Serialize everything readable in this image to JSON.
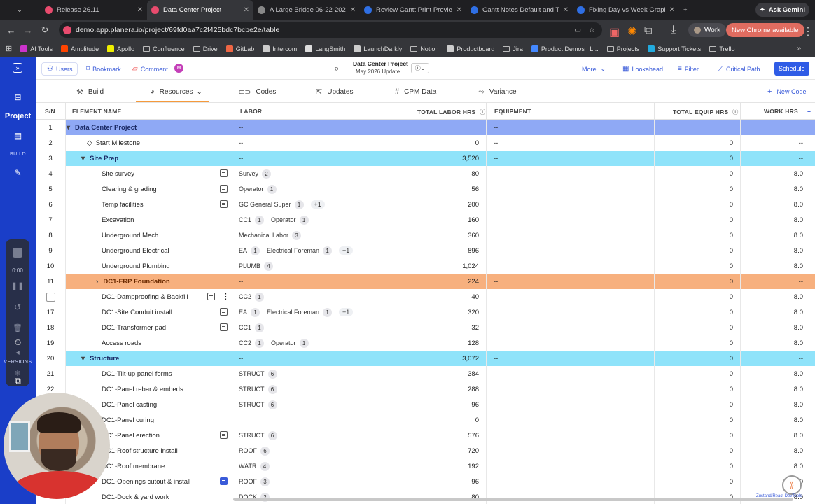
{
  "browser": {
    "tabs": [
      {
        "label": "Release 26.11",
        "icon": "planera-icon"
      },
      {
        "label": "Data Center Project",
        "icon": "planera-icon",
        "active": true
      },
      {
        "label": "A Large Bridge 06-22-202",
        "icon": "globe-icon"
      },
      {
        "label": "Review Gantt Print Preview",
        "icon": "doc-icon"
      },
      {
        "label": "Gantt Notes Default and T",
        "icon": "doc-icon"
      },
      {
        "label": "Fixing Day vs Week Graph",
        "icon": "doc-icon"
      }
    ],
    "ask_gemini": "Ask Gemini",
    "url": "demo.app.planera.io/project/69fd0aa7c2f425bdc7bcbe2e/table",
    "profile": "Work",
    "update_label": "New Chrome available",
    "bookmarks": [
      "AI Tools",
      "Amplitude",
      "Apollo",
      "Confluence",
      "Drive",
      "GitLab",
      "Intercom",
      "LangSmith",
      "LaunchDarkly",
      "Notion",
      "Productboard",
      "Jira",
      "Product Demos | L...",
      "Projects",
      "Support Tickets",
      "Trello"
    ]
  },
  "rail": {
    "project_label": "Project",
    "build_label": "BUILD",
    "versions_label": "VERSIONS",
    "timer": "0:00"
  },
  "toolbar": {
    "users": "Users",
    "bookmark": "Bookmark",
    "comment": "Comment",
    "avatar_letter": "M",
    "project_title": "Data Center Project",
    "project_subtitle": "May 2026 Update",
    "more": "More",
    "lookahead": "Lookahead",
    "filter": "Filter",
    "critical_path": "Critical Path",
    "schedule": "Schedule"
  },
  "subnav": {
    "build": "Build",
    "resources": "Resources",
    "codes": "Codes",
    "updates": "Updates",
    "cpm": "CPM Data",
    "variance": "Variance",
    "new_code": "New Code"
  },
  "columns": {
    "sn": "S/N",
    "name": "ELEMENT NAME",
    "labor": "LABOR",
    "total_labor": "TOTAL LABOR HRS",
    "equipment": "EQUIPMENT",
    "total_equip": "TOTAL EQUIP HRS",
    "work_hrs": "WORK HRS"
  },
  "rows": [
    {
      "sn": "1",
      "name": "Data Center Project",
      "style": "l0",
      "indent": 0,
      "caret": "▾",
      "labor": "--",
      "chips": [],
      "total": "",
      "equip": "--",
      "teq": "",
      "work": ""
    },
    {
      "sn": "2",
      "name": "Start Milestone",
      "style": "",
      "indent": 1,
      "milestone": true,
      "labor": "--",
      "chips": [],
      "total": "0",
      "equip": "--",
      "teq": "0",
      "work": "--"
    },
    {
      "sn": "3",
      "name": "Site Prep",
      "style": "l1",
      "indent": 1,
      "caret": "▾",
      "labor": "--",
      "chips": [],
      "total": "3,520",
      "equip": "--",
      "teq": "0",
      "work": "--"
    },
    {
      "sn": "4",
      "name": "Site survey",
      "style": "",
      "indent": 2,
      "note": true,
      "chips": [
        {
          "t": "Survey",
          "n": "2"
        }
      ],
      "total": "80",
      "teq": "0",
      "work": "8.0"
    },
    {
      "sn": "5",
      "name": "Clearing & grading",
      "style": "",
      "indent": 2,
      "note": true,
      "chips": [
        {
          "t": "Operator",
          "n": "1"
        }
      ],
      "total": "56",
      "teq": "0",
      "work": "8.0"
    },
    {
      "sn": "6",
      "name": "Temp facilities",
      "style": "",
      "indent": 2,
      "note": true,
      "chips": [
        {
          "t": "GC General Super",
          "n": "1"
        }
      ],
      "plus": "+1",
      "total": "200",
      "teq": "0",
      "work": "8.0"
    },
    {
      "sn": "7",
      "name": "Excavation",
      "style": "",
      "indent": 2,
      "chips": [
        {
          "t": "CC1",
          "n": "1"
        },
        {
          "t": "Operator",
          "n": "1"
        }
      ],
      "total": "160",
      "teq": "0",
      "work": "8.0"
    },
    {
      "sn": "8",
      "name": "Underground Mech",
      "style": "",
      "indent": 2,
      "chips": [
        {
          "t": "Mechanical Labor",
          "n": "3"
        }
      ],
      "total": "360",
      "teq": "0",
      "work": "8.0"
    },
    {
      "sn": "9",
      "name": "Underground Electrical",
      "style": "",
      "indent": 2,
      "chips": [
        {
          "t": "EA",
          "n": "1"
        },
        {
          "t": "Electrical Foreman",
          "n": "1"
        }
      ],
      "plus": "+1",
      "total": "896",
      "teq": "0",
      "work": "8.0"
    },
    {
      "sn": "10",
      "name": "Underground Plumbing",
      "style": "",
      "indent": 2,
      "chips": [
        {
          "t": "PLUMB",
          "n": "4"
        }
      ],
      "total": "1,024",
      "teq": "0",
      "work": "8.0"
    },
    {
      "sn": "11",
      "name": "DC1-FRP Foundation",
      "style": "orange",
      "indent": 2,
      "caret": "›",
      "labor": "--",
      "chips": [],
      "total": "224",
      "equip": "--",
      "teq": "0",
      "work": "--"
    },
    {
      "sn": "",
      "checkbox": true,
      "name": "DC1-Dampproofing & Backfill",
      "style": "",
      "indent": 2,
      "note": true,
      "kebab": true,
      "chips": [
        {
          "t": "CC2",
          "n": "1"
        }
      ],
      "total": "40",
      "teq": "0",
      "work": "8.0"
    },
    {
      "sn": "17",
      "name": "DC1-Site Conduit install",
      "style": "",
      "indent": 2,
      "note": true,
      "chips": [
        {
          "t": "EA",
          "n": "1"
        },
        {
          "t": "Electrical Foreman",
          "n": "1"
        }
      ],
      "plus": "+1",
      "total": "320",
      "teq": "0",
      "work": "8.0"
    },
    {
      "sn": "18",
      "name": "DC1-Transformer pad",
      "style": "",
      "indent": 2,
      "note": true,
      "chips": [
        {
          "t": "CC1",
          "n": "1"
        }
      ],
      "total": "32",
      "teq": "0",
      "work": "8.0"
    },
    {
      "sn": "19",
      "name": "Access roads",
      "style": "",
      "indent": 2,
      "chips": [
        {
          "t": "CC2",
          "n": "1"
        },
        {
          "t": "Operator",
          "n": "1"
        }
      ],
      "total": "128",
      "teq": "0",
      "work": "8.0"
    },
    {
      "sn": "20",
      "name": "Structure",
      "style": "l1",
      "indent": 1,
      "caret": "▾",
      "labor": "--",
      "chips": [],
      "total": "3,072",
      "equip": "--",
      "teq": "0",
      "work": "--"
    },
    {
      "sn": "21",
      "name": "DC1-Tilt-up panel forms",
      "style": "",
      "indent": 2,
      "chips": [
        {
          "t": "STRUCT",
          "n": "6"
        }
      ],
      "total": "384",
      "teq": "0",
      "work": "8.0"
    },
    {
      "sn": "22",
      "name": "DC1-Panel rebar & embeds",
      "style": "",
      "indent": 2,
      "chips": [
        {
          "t": "STRUCT",
          "n": "6"
        }
      ],
      "total": "288",
      "teq": "0",
      "work": "8.0"
    },
    {
      "sn": "",
      "name": "DC1-Panel casting",
      "style": "",
      "indent": 2,
      "chips": [
        {
          "t": "STRUCT",
          "n": "6"
        }
      ],
      "total": "96",
      "teq": "0",
      "work": "8.0"
    },
    {
      "sn": "",
      "name": "DC1-Panel curing",
      "style": "",
      "indent": 2,
      "chips": [],
      "total": "0",
      "teq": "0",
      "work": "8.0"
    },
    {
      "sn": "",
      "name": "DC1-Panel erection",
      "style": "",
      "indent": 2,
      "note": true,
      "chips": [
        {
          "t": "STRUCT",
          "n": "6"
        }
      ],
      "total": "576",
      "teq": "0",
      "work": "8.0"
    },
    {
      "sn": "",
      "name": "DC1-Roof structure install",
      "style": "",
      "indent": 2,
      "chips": [
        {
          "t": "ROOF",
          "n": "6"
        }
      ],
      "total": "720",
      "teq": "0",
      "work": "8.0"
    },
    {
      "sn": "",
      "name": "DC1-Roof membrane",
      "style": "",
      "indent": 2,
      "chips": [
        {
          "t": "WATR",
          "n": "4"
        }
      ],
      "total": "192",
      "teq": "0",
      "work": "8.0"
    },
    {
      "sn": "",
      "name": "DC1-Openings cutout & install",
      "style": "",
      "indent": 2,
      "note": true,
      "noteblue": true,
      "chips": [
        {
          "t": "ROOF",
          "n": "3"
        }
      ],
      "total": "96",
      "teq": "0",
      "work": "8.0"
    },
    {
      "sn": "",
      "name": "DC1-Dock & yard work",
      "style": "",
      "indent": 2,
      "chips": [
        {
          "t": "DOCK",
          "n": "2"
        }
      ],
      "total": "80",
      "teq": "0",
      "work": "8.0"
    }
  ],
  "devtools_label": "Zustand/React DevTools"
}
